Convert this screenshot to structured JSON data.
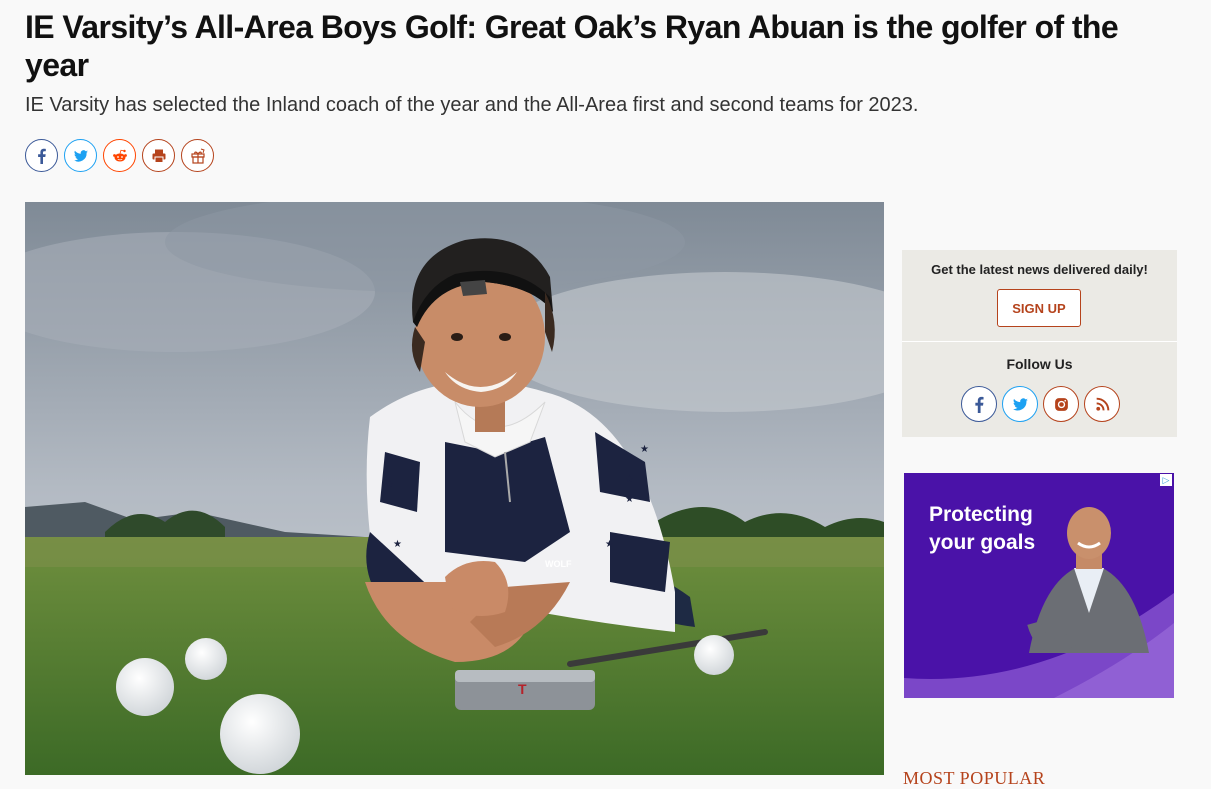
{
  "article": {
    "headline": "IE Varsity’s All-Area Boys Golf: Great Oak’s Ryan Abuan is the golfer of the year",
    "subheadline": "IE Varsity has selected the Inland coach of the year and the All-Area first and second teams for 2023."
  },
  "share": {
    "buttons": [
      {
        "icon": "facebook-icon",
        "color": "#3b5998"
      },
      {
        "icon": "twitter-icon",
        "color": "#1da1f2"
      },
      {
        "icon": "reddit-icon",
        "color": "#ff4500"
      },
      {
        "icon": "print-icon",
        "color": "#b5431c"
      },
      {
        "icon": "gift-icon",
        "color": "#b5431c"
      }
    ]
  },
  "newsletter": {
    "title": "Get the latest news delivered daily!",
    "signup_label": "SIGN UP"
  },
  "follow": {
    "title": "Follow Us",
    "buttons": [
      {
        "icon": "facebook-icon",
        "color": "#3b5998"
      },
      {
        "icon": "twitter-icon",
        "color": "#1da1f2"
      },
      {
        "icon": "instagram-icon",
        "color": "#b5431c"
      },
      {
        "icon": "rss-icon",
        "color": "#b5431c"
      }
    ]
  },
  "ad": {
    "headline": "Protecting\nyour goals",
    "choices_icon": "ad-choices-icon"
  },
  "sidebar": {
    "most_popular_label": "MOST POPULAR"
  },
  "colors": {
    "accent": "#b5431c",
    "ad_bg": "#4a12a8",
    "newsletter_bg": "#ebeae5"
  }
}
